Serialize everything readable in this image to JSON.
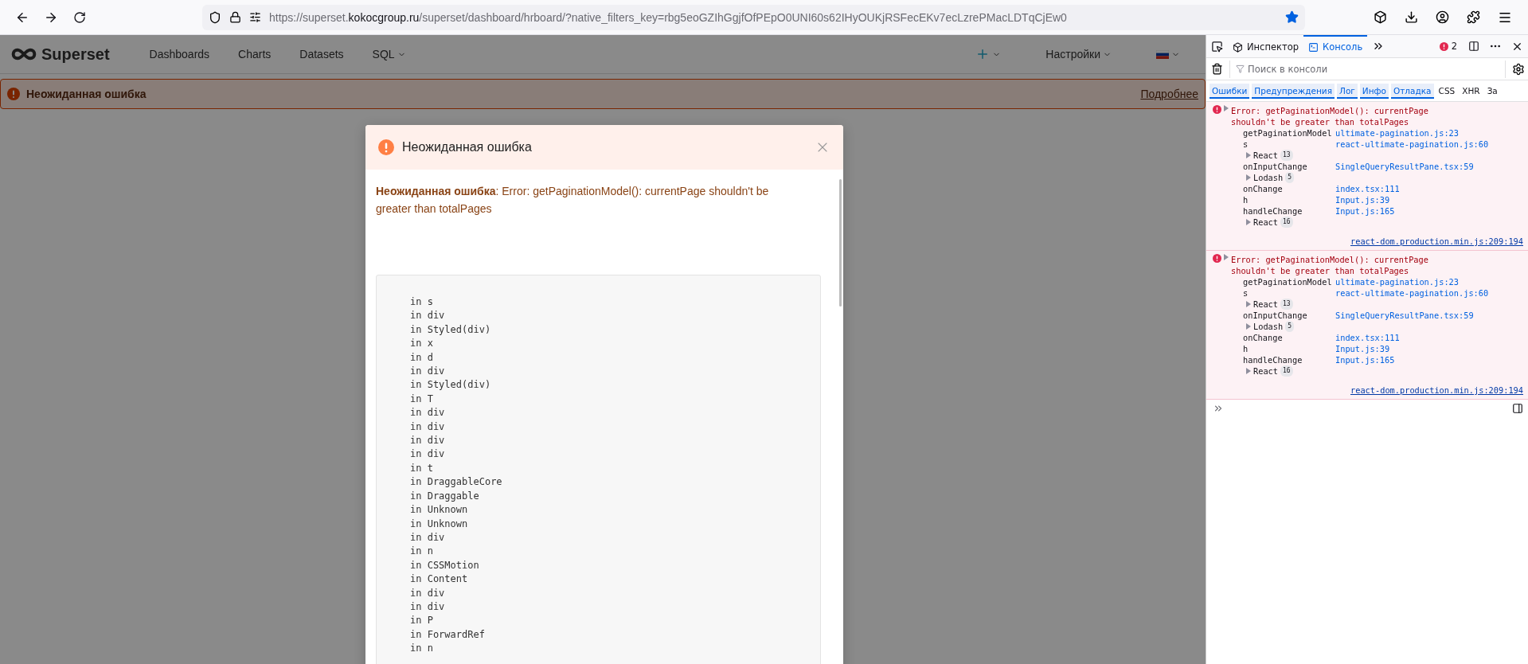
{
  "browser": {
    "url_scheme": "https://superset.",
    "url_domain": "kokocgroup.ru",
    "url_path": "/superset/dashboard/hrboard/?native_filters_key=rbg5eoGZIhGgjfOfPEpO0UNI60s62IHyOUKjRSFecEKv7ecLzrePMacLDTqCjEw0",
    "bookmarked": true
  },
  "nav": {
    "brand": "Superset",
    "items": [
      {
        "label": "Dashboards",
        "kind": "link"
      },
      {
        "label": "Charts",
        "kind": "link"
      },
      {
        "label": "Datasets",
        "kind": "link"
      },
      {
        "label": "SQL",
        "kind": "dropdown"
      }
    ],
    "settings": "Настройки"
  },
  "banner": {
    "title": "Неожиданная ошибка",
    "link": "Подробнее"
  },
  "modal": {
    "title": "Неожиданная ошибка",
    "message": "**Неожиданная ошибка**: Error: getPaginationModel(): currentPage shouldn't be greater than totalPages",
    "stack": [
      "in s",
      "in div",
      "in Styled(div)",
      "in x",
      "in d",
      "in div",
      "in Styled(div)",
      "in T",
      "in div",
      "in div",
      "in div",
      "in div",
      "in t",
      "in DraggableCore",
      "in Draggable",
      "in Unknown",
      "in Unknown",
      "in div",
      "in n",
      "in CSSMotion",
      "in Content",
      "in div",
      "in div",
      "in P",
      "in ForwardRef",
      "in n"
    ]
  },
  "devtools": {
    "tabs": [
      {
        "label": "Инспектор",
        "selected": false
      },
      {
        "label": "Консоль",
        "selected": true
      }
    ],
    "error_count": "2",
    "search": {
      "placeholder": "Поиск в консоли"
    },
    "filters": [
      {
        "label": "Ошибки",
        "on": true
      },
      {
        "label": "Предупреждения",
        "on": true
      },
      {
        "label": "Лог",
        "on": true
      },
      {
        "label": "Инфо",
        "on": true
      },
      {
        "label": "Отладка",
        "on": true
      },
      {
        "label": "CSS",
        "on": false
      },
      {
        "label": "XHR",
        "on": false
      },
      {
        "label": "За",
        "on": false
      }
    ],
    "messages": [
      {
        "text": "Error: getPaginationModel(): currentPage shouldn't be greater than totalPages",
        "location": "react-dom.production.min.js:209:194",
        "frames": [
          {
            "kind": "frame",
            "name": "getPaginationModel",
            "source": "ultimate-pagination.js:23"
          },
          {
            "kind": "frame",
            "name": "s",
            "source": "react-ultimate-pagination.js:60"
          },
          {
            "kind": "group",
            "name": "React",
            "count": "13"
          },
          {
            "kind": "frame",
            "name": "onInputChange",
            "source": "SingleQueryResultPane.tsx:59"
          },
          {
            "kind": "group",
            "name": "Lodash",
            "count": "5"
          },
          {
            "kind": "frame",
            "name": "onChange",
            "source": "index.tsx:111"
          },
          {
            "kind": "frame",
            "name": "h",
            "source": "Input.js:39"
          },
          {
            "kind": "frame",
            "name": "handleChange",
            "source": "Input.js:165"
          },
          {
            "kind": "group",
            "name": "React",
            "count": "16"
          }
        ]
      },
      {
        "text": "Error: getPaginationModel(): currentPage shouldn't be greater than totalPages",
        "location": "react-dom.production.min.js:209:194",
        "frames": [
          {
            "kind": "frame",
            "name": "getPaginationModel",
            "source": "ultimate-pagination.js:23"
          },
          {
            "kind": "frame",
            "name": "s",
            "source": "react-ultimate-pagination.js:60"
          },
          {
            "kind": "group",
            "name": "React",
            "count": "13"
          },
          {
            "kind": "frame",
            "name": "onInputChange",
            "source": "SingleQueryResultPane.tsx:59"
          },
          {
            "kind": "group",
            "name": "Lodash",
            "count": "5"
          },
          {
            "kind": "frame",
            "name": "onChange",
            "source": "index.tsx:111"
          },
          {
            "kind": "frame",
            "name": "h",
            "source": "Input.js:39"
          },
          {
            "kind": "frame",
            "name": "handleChange",
            "source": "Input.js:165"
          },
          {
            "kind": "group",
            "name": "React",
            "count": "16"
          }
        ]
      }
    ]
  }
}
